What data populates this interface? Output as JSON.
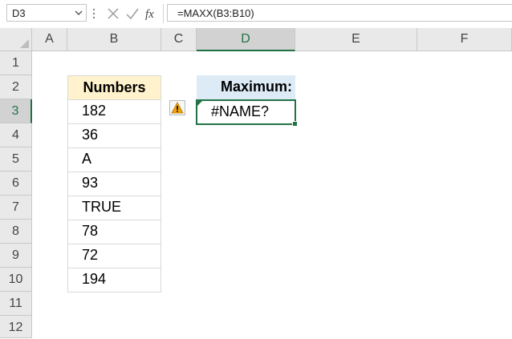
{
  "formula_bar": {
    "name_box": "D3",
    "formula": "=MAXX(B3:B10)",
    "icons": [
      "chevron-down-icon",
      "more-dots-icon",
      "cancel-x-icon",
      "enter-check-icon",
      "fx-icon"
    ]
  },
  "columns": [
    "A",
    "B",
    "C",
    "D",
    "E",
    "F"
  ],
  "selected_column": "D",
  "rows": [
    "1",
    "2",
    "3",
    "4",
    "5",
    "6",
    "7",
    "8",
    "9",
    "10",
    "11",
    "12"
  ],
  "selected_row": "3",
  "table_b": {
    "header": "Numbers",
    "values": [
      "182",
      "36",
      "A",
      "93",
      "TRUE",
      "78",
      "72",
      "194"
    ]
  },
  "table_d": {
    "header": "Maximum:",
    "value": "#NAME?"
  },
  "warning_icon": "warning-triangle-icon",
  "colors": {
    "accent": "#217346",
    "header_b_fill": "#fff2cc",
    "header_d_fill": "#ddebf7",
    "warning": "#f0a30a"
  }
}
